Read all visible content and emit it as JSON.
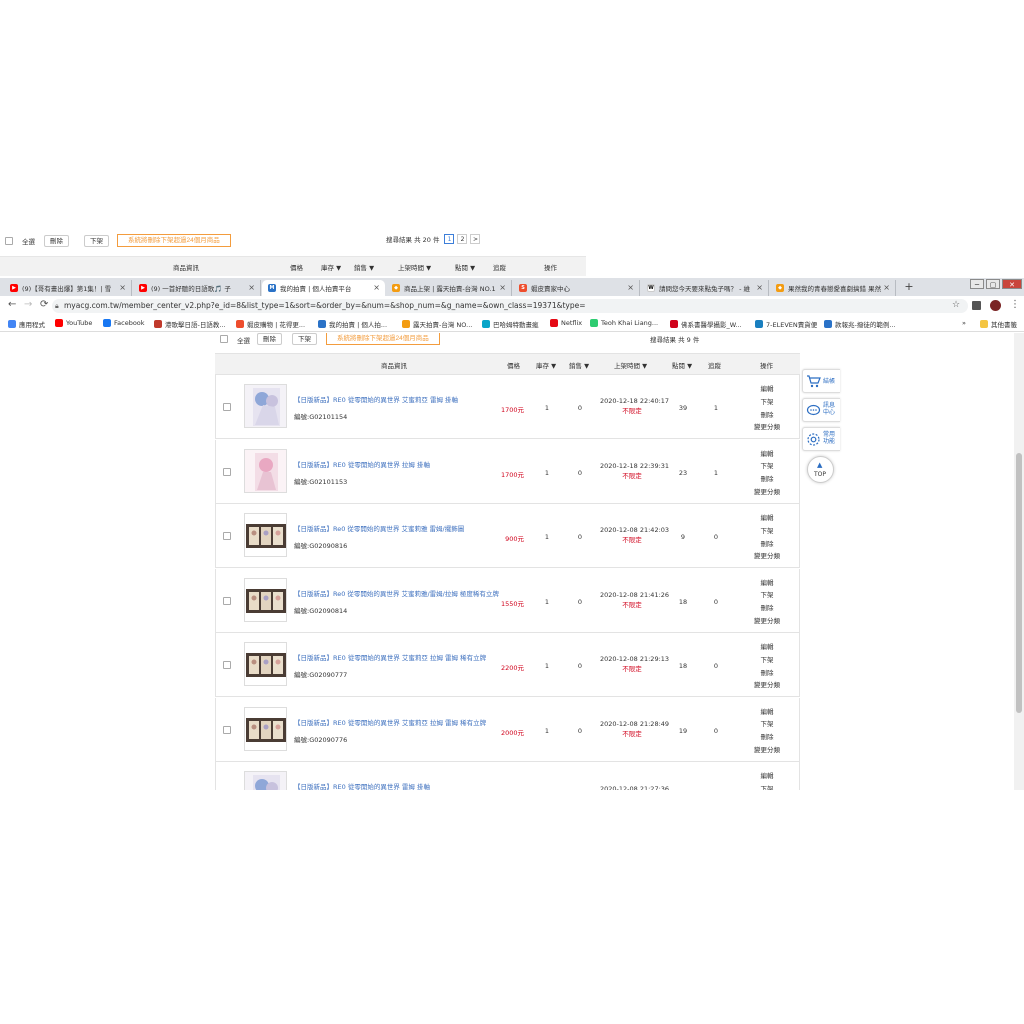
{
  "ghost": {
    "select_all": "全選",
    "delete": "刪除",
    "unlist": "下架",
    "auto_delete_notice": "系統將刪除下架超過24個月商品",
    "result_text": "搜尋結果 共 20 件",
    "page1": "1",
    "page2": "2",
    "next": ">",
    "headers": {
      "info": "商品資訊",
      "price": "價格",
      "stock": "庫存 ▼",
      "sold": "銷售 ▼",
      "listed": "上架時間 ▼",
      "clicks": "點閱 ▼",
      "bids": "追蹤",
      "ops": "操作"
    }
  },
  "browser": {
    "tabs": [
      {
        "title": "(9)【哥有畫出爆】第1集！| 雪",
        "fav_color": "#ff0000",
        "fav_glyph": "▶"
      },
      {
        "title": "(9) 一首好聽的日語歌🎵 子",
        "fav_color": "#ff0000",
        "fav_glyph": "▶"
      },
      {
        "title": "我的拍賣 | 個人拍賣平台",
        "fav_color": "#2a72c7",
        "fav_glyph": "M"
      },
      {
        "title": "商品上架 | 露天拍賣-台灣 NO.1",
        "fav_color": "#f39c12",
        "fav_glyph": "◆"
      },
      {
        "title": "蝦皮賣家中心",
        "fav_color": "#ee4d2d",
        "fav_glyph": "S"
      },
      {
        "title": "請問您今天要來點兔子嗎？ - 維",
        "fav_color": "#ffffff",
        "fav_glyph": "W"
      },
      {
        "title": "果然我的青春戀愛喜劇搞錯 果然",
        "fav_color": "#f39c12",
        "fav_glyph": "◆"
      }
    ],
    "close_glyph": "×",
    "new_tab_glyph": "+",
    "url": "myacg.com.tw/member_center_v2.php?e_id=8&list_type=1&sort=&order_by=&num=&shop_num=&g_name=&own_class=19371&type=",
    "bookmarks": [
      {
        "label": "應用程式",
        "color": "#4285f4"
      },
      {
        "label": "YouTube",
        "color": "#ff0000"
      },
      {
        "label": "Facebook",
        "color": "#1877f2"
      },
      {
        "label": "港歌擊日語-日語教...",
        "color": "#c0392b"
      },
      {
        "label": "蝦皮購物 | 花得更...",
        "color": "#ee4d2d"
      },
      {
        "label": "我的拍賣 | 個人拍...",
        "color": "#2a72c7"
      },
      {
        "label": "露天拍賣-台灣 NO...",
        "color": "#f39c12"
      },
      {
        "label": "巴哈姆特動畫瘋",
        "color": "#0aa5c8"
      },
      {
        "label": "Netflix",
        "color": "#e50914"
      },
      {
        "label": "Teoh Khai Liang...",
        "color": "#2ecc71"
      },
      {
        "label": "佛系書醫學攝影_W...",
        "color": "#d0021b"
      },
      {
        "label": "7-ELEVEN賣貨便",
        "color": "#1a7fbf"
      },
      {
        "label": "款報兆-撥徒的範例...",
        "color": "#2a72c7"
      },
      {
        "label": "其他書籤",
        "color": "#f4c542"
      }
    ],
    "more_bookmarks": "»"
  },
  "page": {
    "select_all": "全選",
    "delete": "刪除",
    "unlist": "下架",
    "auto_delete_notice": "系統將刪除下架超過24個月商品",
    "result_text": "搜尋結果 共 9 件",
    "headers": {
      "info": "商品資訊",
      "price": "價格",
      "stock": "庫存 ▼",
      "sold": "銷售 ▼",
      "listed": "上架時間 ▼",
      "clicks": "點閱 ▼",
      "bids": "追蹤",
      "ops": "操作"
    },
    "op_labels": [
      "編輯",
      "下架",
      "刪除",
      "變更分類"
    ],
    "no_limit": "不限定",
    "rows": [
      {
        "name": "【日版新品】RE0 從零開始的異世界 艾蜜莉亞 雷姆 掛軸",
        "code": "編號:G02101154",
        "price": "1700元",
        "stock": "1",
        "sold": "0",
        "date": "2020-12-18 22:40:17",
        "clicks": "39",
        "bids": "1",
        "thumb": "a"
      },
      {
        "name": "【日版新品】RE0 從零開始的異世界 拉姆 掛軸",
        "code": "編號:G02101153",
        "price": "1700元",
        "stock": "1",
        "sold": "0",
        "date": "2020-12-18 22:39:31",
        "clicks": "23",
        "bids": "1",
        "thumb": "b"
      },
      {
        "name": "【日版新品】Re0 從零開始的異世界 艾蜜莉雅 雷姆/擺飾圖",
        "code": "編號:G02090816",
        "price": "900元",
        "stock": "1",
        "sold": "0",
        "date": "2020-12-08 21:42:03",
        "clicks": "9",
        "bids": "0",
        "thumb": "c"
      },
      {
        "name": "【日版新品】Re0 從零開始的異世界 艾蜜莉雅/雷姆/拉姆 極度稀有立牌",
        "code": "編號:G02090814",
        "price": "1550元",
        "stock": "1",
        "sold": "0",
        "date": "2020-12-08 21:41:26",
        "clicks": "18",
        "bids": "0",
        "thumb": "c"
      },
      {
        "name": "【日版新品】RE0 從零開始的異世界 艾蜜莉亞 拉姆 雷姆 稀有立牌",
        "code": "編號:G02090777",
        "price": "2200元",
        "stock": "1",
        "sold": "0",
        "date": "2020-12-08 21:29:13",
        "clicks": "18",
        "bids": "0",
        "thumb": "c"
      },
      {
        "name": "【日版新品】RE0 從零開始的異世界 艾蜜莉亞 拉姆 雷姆 稀有立牌",
        "code": "編號:G02090776",
        "price": "2000元",
        "stock": "1",
        "sold": "0",
        "date": "2020-12-08 21:28:49",
        "clicks": "19",
        "bids": "0",
        "thumb": "c"
      },
      {
        "name": "【日版新品】RE0 從零開始的異世界 雷姆 掛軸",
        "code": "",
        "price": "",
        "stock": "",
        "sold": "",
        "date": "2020-12-08 21:27:36",
        "clicks": "",
        "bids": "",
        "thumb": "a"
      }
    ],
    "side": {
      "cart": "結帳",
      "message": "訊息中心",
      "common": "常用功能",
      "top": "TOP"
    }
  }
}
